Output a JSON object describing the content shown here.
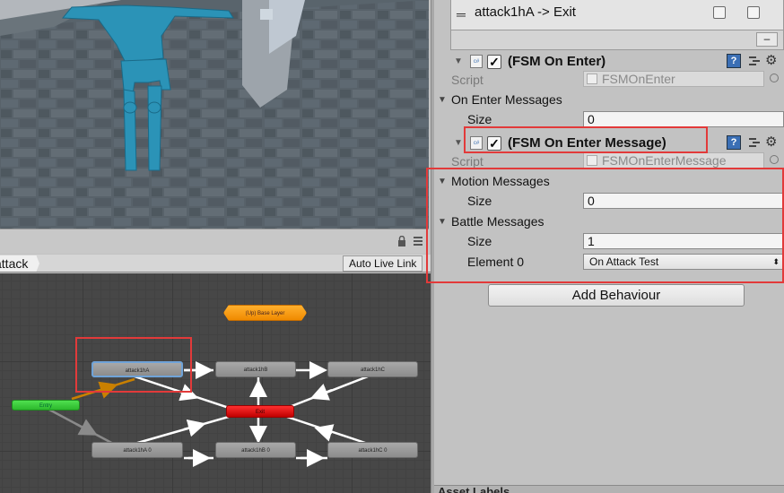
{
  "animator": {
    "breadcrumb": "attack",
    "auto_live_link": "Auto Live Link",
    "nodes": {
      "up_base_layer": "(Up) Base Layer",
      "attack1hA": "attack1hA",
      "attack1hB": "attack1hB",
      "attack1hC": "attack1hC",
      "entry": "Entry",
      "exit": "Exit",
      "attack1hA0": "attack1hA 0",
      "attack1hB0": "attack1hB 0",
      "attack1hC0": "attack1hC 0"
    }
  },
  "inspector": {
    "transition": {
      "label": "attack1hA -> Exit",
      "minus": "–"
    },
    "fsm_on_enter": {
      "title": "(FSM On Enter)",
      "script_label": "Script",
      "script_value": "FSMOnEnter",
      "on_enter_messages_label": "On Enter Messages",
      "size_label": "Size",
      "size_value": "0"
    },
    "fsm_on_enter_message": {
      "title": "(FSM On Enter Message)",
      "script_label": "Script",
      "script_value": "FSMOnEnterMessage",
      "motion_messages_label": "Motion Messages",
      "motion_size_label": "Size",
      "motion_size_value": "0",
      "battle_messages_label": "Battle Messages",
      "battle_size_label": "Size",
      "battle_size_value": "1",
      "element0_label": "Element 0",
      "element0_value": "On Attack Test"
    },
    "add_behaviour": "Add Behaviour",
    "asset_labels": "Asset Labels"
  },
  "colors": {
    "highlight": "#e23a3a",
    "entry": "#2cb82c",
    "exit": "#d00000",
    "up_layer": "#f08a00",
    "character": "#2a93b8"
  }
}
